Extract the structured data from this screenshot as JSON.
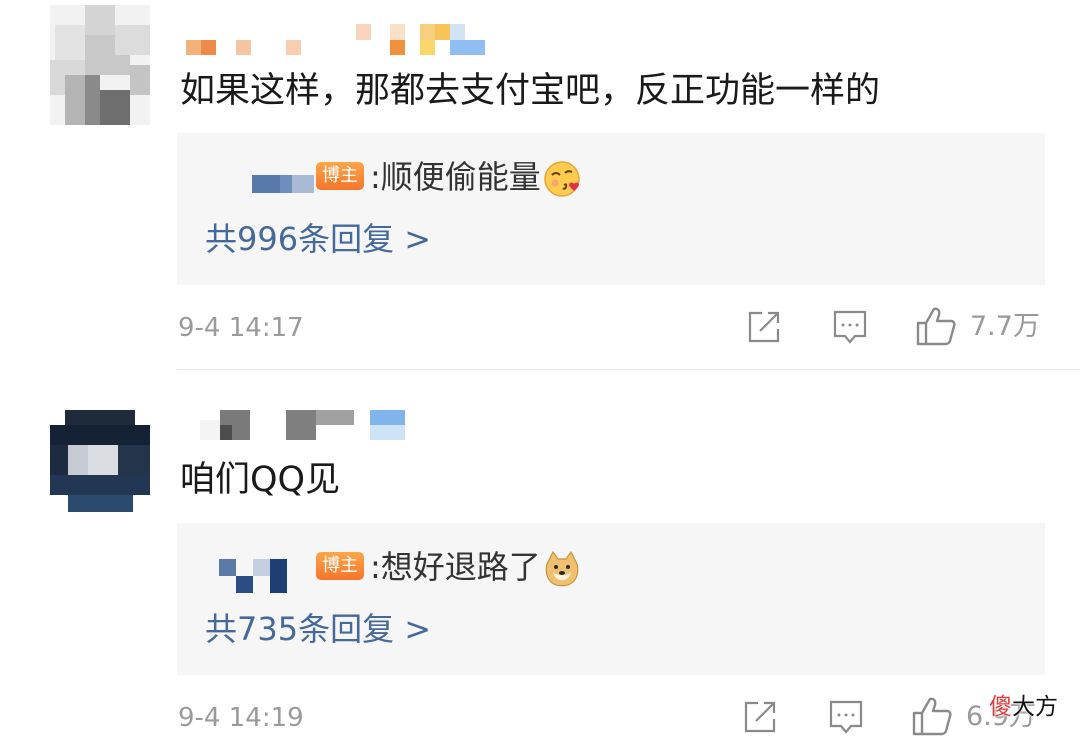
{
  "comments": [
    {
      "text": "如果这样，那都去支付宝吧，反正功能一样的",
      "reply": {
        "badge": "博主",
        "text": ":顺便偷能量",
        "more": "共996条回复 >"
      },
      "time": "9-4 14:17",
      "likes": "7.7万",
      "icons": [
        "share-icon",
        "comment-icon",
        "like-icon",
        "kissing-emoji-icon"
      ]
    },
    {
      "text": "咱们QQ见",
      "reply": {
        "badge": "博主",
        "text": ":想好退路了",
        "more": "共735条回复 >"
      },
      "time": "9-4 14:19",
      "likes": "6.9万",
      "icons": [
        "share-icon",
        "comment-icon",
        "like-icon",
        "doge-emoji-icon"
      ]
    }
  ],
  "watermark": {
    "char1": "傻",
    "rest": "大方"
  },
  "colors": {
    "link": "#46699b",
    "badge": "#f5752a",
    "muted": "#9a9a9a",
    "reply_bg": "#f6f6f6"
  }
}
